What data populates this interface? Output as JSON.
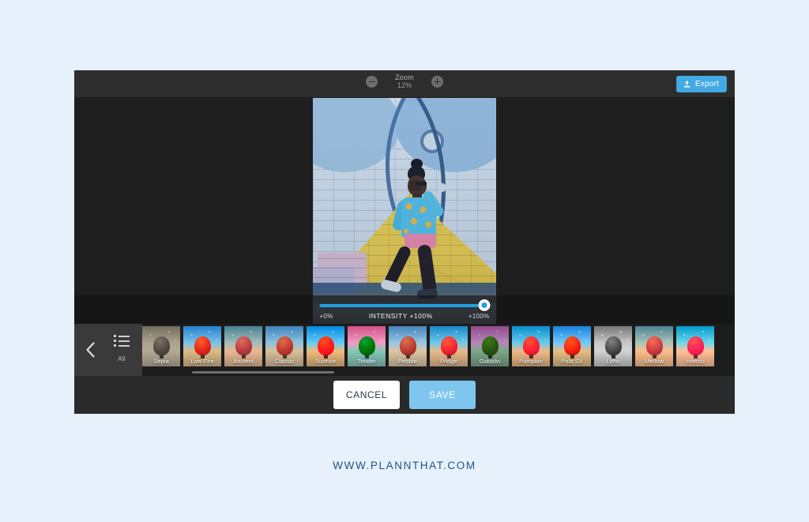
{
  "page": {
    "background_color": "#e6f1fc",
    "footer_text": "WWW.PLANNTHAT.COM",
    "footer_color": "#25527e"
  },
  "app": {
    "accent_color": "#43a9e2",
    "save_color": "#7ec6ee",
    "window_background": "#222222"
  },
  "toolbar": {
    "zoom_label": "Zoom",
    "zoom_value": "12%",
    "zoom_out_icon": "minus-circle-icon",
    "zoom_in_icon": "plus-circle-icon",
    "export_label": "Export",
    "export_icon": "upload-icon"
  },
  "slider": {
    "min_label": "+0%",
    "center_label": "INTENSITY +100%",
    "max_label": "+100%",
    "value_percent": 100,
    "track_color": "#1f9fe0"
  },
  "filter_panel": {
    "back_icon": "chevron-left-icon",
    "all_icon": "list-icon",
    "all_label": "All",
    "filters": [
      {
        "label": "Sepia",
        "class": "f-sepia"
      },
      {
        "label": "Low Fire",
        "class": "f-lowfire"
      },
      {
        "label": "Ancient",
        "class": "f-ancient"
      },
      {
        "label": "Classic",
        "class": "f-classic"
      },
      {
        "label": "Sunrise",
        "class": "f-sunrise"
      },
      {
        "label": "Tender",
        "class": "f-tender"
      },
      {
        "label": "Pebble",
        "class": "f-pebble"
      },
      {
        "label": "Fridge",
        "class": "f-fridge"
      },
      {
        "label": "Gobblin",
        "class": "f-gobblin"
      },
      {
        "label": "Pumpkin",
        "class": "f-pumpkin"
      },
      {
        "label": "Pola SX",
        "class": "f-polasx"
      },
      {
        "label": "Litho",
        "class": "f-litho"
      },
      {
        "label": "Mellow",
        "class": "f-mellow"
      },
      {
        "label": "Inferno",
        "class": "f-inferno"
      }
    ]
  },
  "actions": {
    "cancel_label": "CANCEL",
    "save_label": "SAVE"
  }
}
